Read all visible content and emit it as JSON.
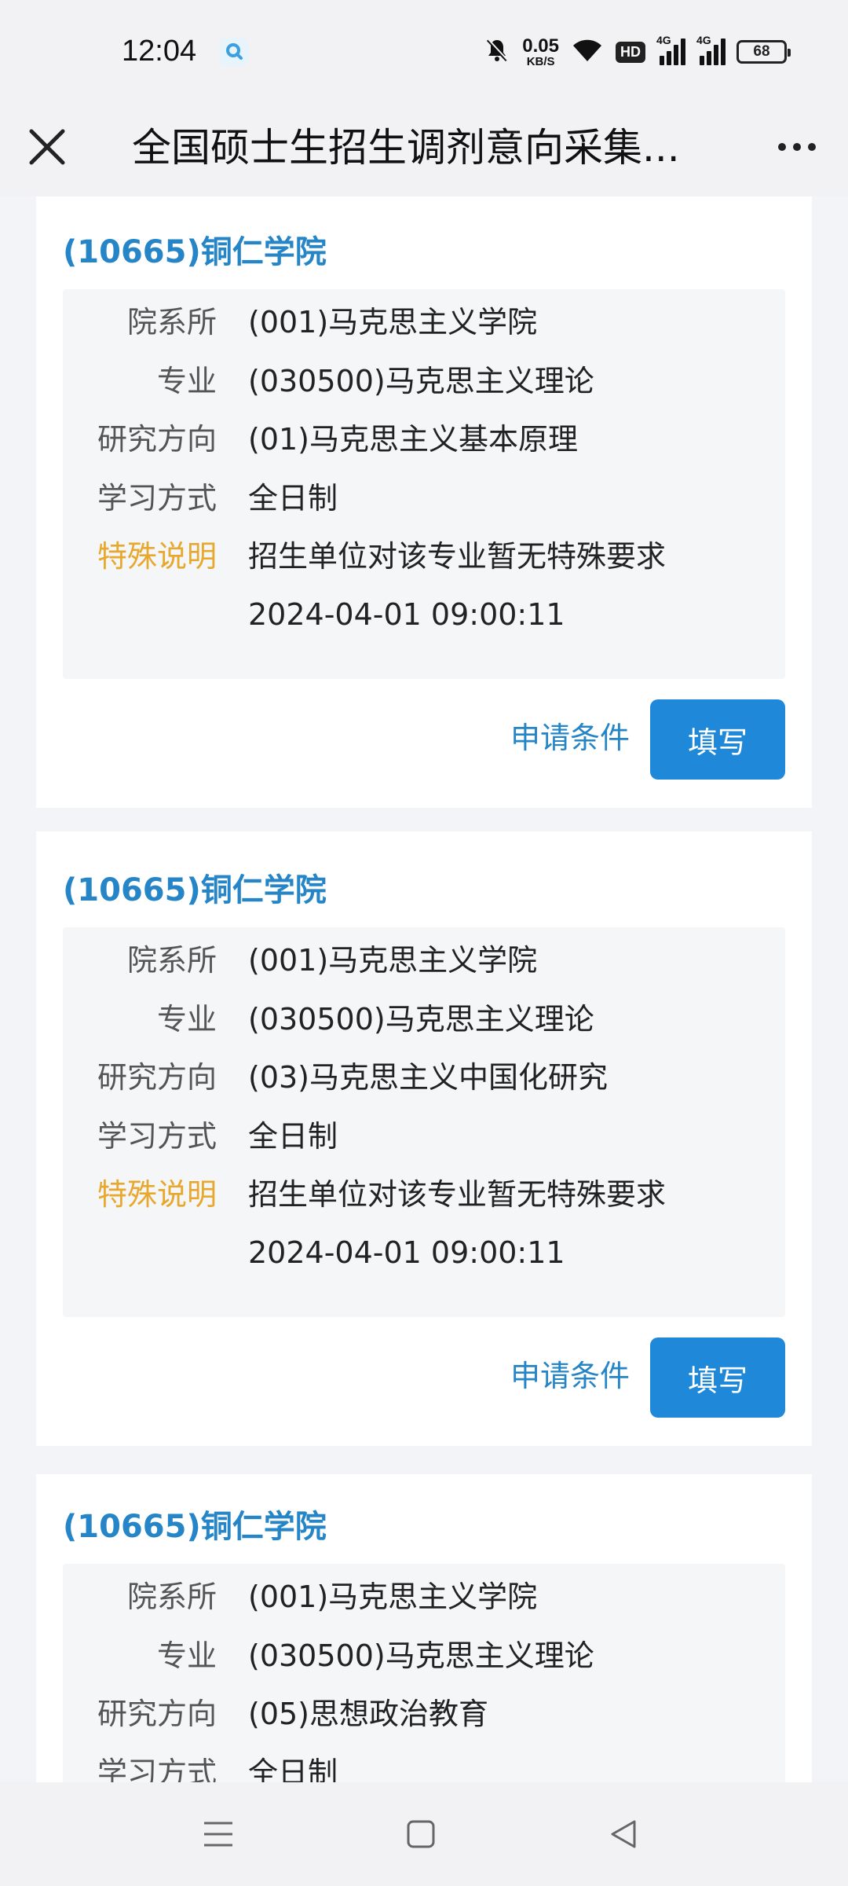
{
  "status": {
    "time": "12:04",
    "net_speed_value": "0.05",
    "net_speed_unit": "KB/S",
    "hd_label": "HD",
    "signal1_label": "4G",
    "signal2_label": "4G",
    "battery": "68",
    "icons": [
      "search-app-icon",
      "mute-icon",
      "wifi-icon",
      "signal-icon",
      "battery-icon"
    ]
  },
  "header": {
    "title": "全国硕士生招生调剂意向采集...",
    "close_icon": "close-icon",
    "more_icon": "more-icon"
  },
  "labels": {
    "department": "院系所",
    "major": "专业",
    "direction": "研究方向",
    "study_mode": "学习方式",
    "special_note": "特殊说明"
  },
  "cards": [
    {
      "school": "(10665)铜仁学院",
      "department": "(001)马克思主义学院",
      "major": "(030500)马克思主义理论",
      "direction": "(01)马克思主义基本原理",
      "study_mode": "全日制",
      "special_note": "招生单位对该专业暂无特殊要求",
      "timestamp": "2024-04-01 09:00:11",
      "apply_link": "申请条件",
      "fill_button": "填写"
    },
    {
      "school": "(10665)铜仁学院",
      "department": "(001)马克思主义学院",
      "major": "(030500)马克思主义理论",
      "direction": "(03)马克思主义中国化研究",
      "study_mode": "全日制",
      "special_note": "招生单位对该专业暂无特殊要求",
      "timestamp": "2024-04-01 09:00:11",
      "apply_link": "申请条件",
      "fill_button": "填写"
    },
    {
      "school": "(10665)铜仁学院",
      "department": "(001)马克思主义学院",
      "major": "(030500)马克思主义理论",
      "direction": "(05)思想政治教育",
      "study_mode": "全日制"
    }
  ],
  "colors": {
    "accent_blue": "#2585c6",
    "button_blue": "#1f88d9",
    "special_orange": "#e7a82d"
  },
  "bottom_nav": [
    "menu-icon",
    "home-icon",
    "back-icon"
  ]
}
